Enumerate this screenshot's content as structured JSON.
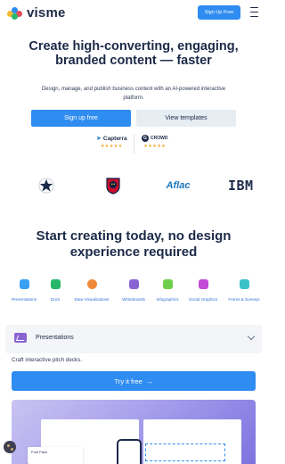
{
  "header": {
    "logo_text": "visme",
    "signup_label": "Sign Up Free"
  },
  "hero": {
    "title": "Create high-converting, engaging, branded content — faster",
    "subtitle": "Design, manage, and publish business content with an AI-powered interactive platform.",
    "primary_cta": "Sign up free",
    "secondary_cta": "View templates"
  },
  "ratings": [
    {
      "name": "Capterra",
      "stars": "★★★★★"
    },
    {
      "name": "CROWD",
      "stars": "★★★★★"
    }
  ],
  "brands": [
    "Aflac",
    "IBM"
  ],
  "section": {
    "title": "Start creating today, no design experience required"
  },
  "categories": [
    {
      "label": "Presentations",
      "color": "#3aa0f3"
    },
    {
      "label": "Docs",
      "color": "#27b86b"
    },
    {
      "label": "Data Visualizations",
      "color": "#f08a3a"
    },
    {
      "label": "Whiteboards",
      "color": "#8a63d2"
    },
    {
      "label": "Infographics",
      "color": "#6fcf4a"
    },
    {
      "label": "Social Graphics",
      "color": "#c34ad8"
    },
    {
      "label": "Forms & Surveys",
      "color": "#3ac2c9"
    }
  ],
  "accordion": {
    "title": "Presentations",
    "description": "Craft interactive pitch decks.",
    "cta": "Try it free",
    "cta_arrow": "→"
  },
  "preview": {
    "font_card": "Font Pairs"
  },
  "colors": {
    "accent": "#2f8cf0",
    "text": "#1c2a48"
  }
}
